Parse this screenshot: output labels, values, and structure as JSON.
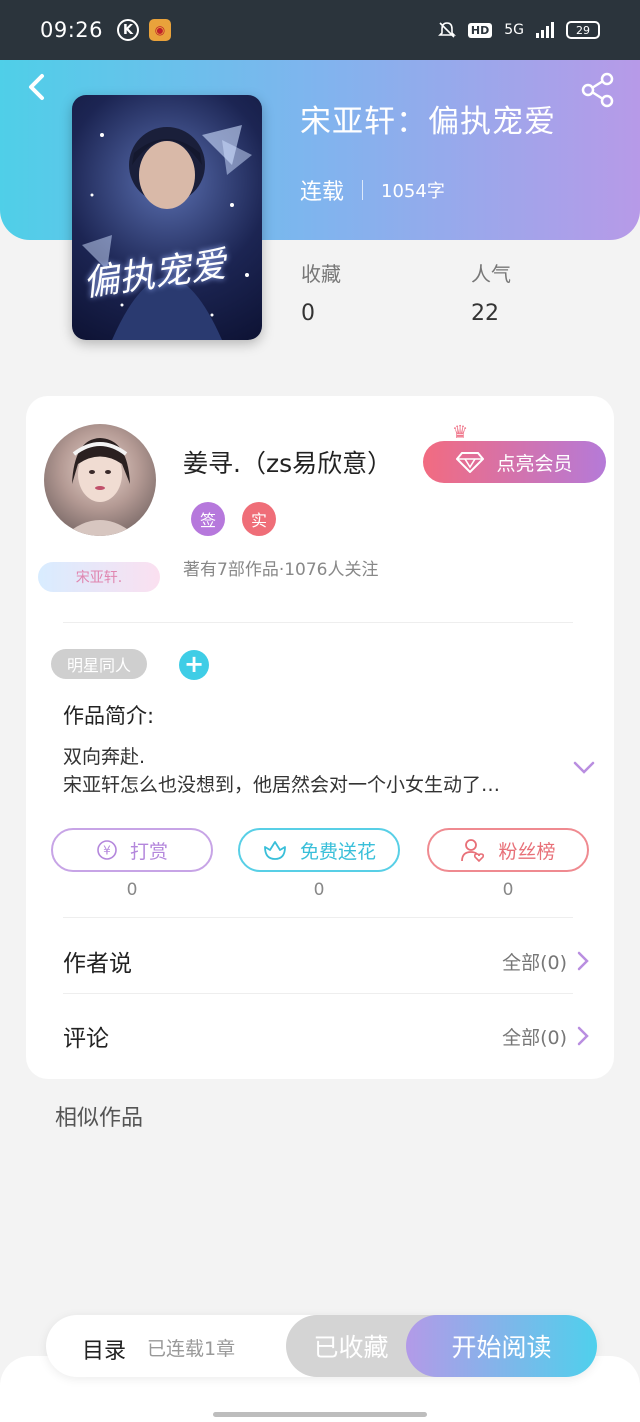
{
  "status_bar": {
    "time": "09:26",
    "k_icon": "K",
    "weibo_icon": "weibo-icon",
    "hd": "HD",
    "network": "5G",
    "battery": "29"
  },
  "header": {
    "back_icon": "back-icon",
    "share_icon": "share-icon",
    "cover_title": "偏执宠爱",
    "book_title": "宋亚轩：偏执宠爱",
    "status": "连载",
    "word_count": "1054字",
    "favorites_label": "收藏",
    "favorites_value": "0",
    "popularity_label": "人气",
    "popularity_value": "22"
  },
  "author": {
    "name": "姜寻.（zs易欣意）",
    "avatar_tag": "宋亚轩.",
    "badge_sign": "签",
    "badge_real": "实",
    "info": "著有7部作品·1076人关注",
    "vip_button": "点亮会员"
  },
  "intro": {
    "genre_tag": "明星同人",
    "label": "作品简介:",
    "line1": "双向奔赴.",
    "line2": "宋亚轩怎么也没想到，他居然会对一个小女生动了…"
  },
  "actions": [
    {
      "label": "打赏",
      "count": "0",
      "icon": "yen-icon"
    },
    {
      "label": "免费送花",
      "count": "0",
      "icon": "flower-icon"
    },
    {
      "label": "粉丝榜",
      "count": "0",
      "icon": "fans-icon"
    }
  ],
  "sections": {
    "author_says": "作者说",
    "author_says_more": "全部(0)",
    "comments": "评论",
    "comments_more": "全部(0)",
    "similar": "相似作品"
  },
  "bottom": {
    "toc": "目录",
    "toc_status": "已连载1章",
    "collected": "已收藏",
    "read": "开始阅读"
  },
  "colors": {
    "header_start": "#4fcfe8",
    "header_end": "#b79ae8",
    "vip_start": "#f26b80",
    "vip_end": "#b57ad8"
  }
}
